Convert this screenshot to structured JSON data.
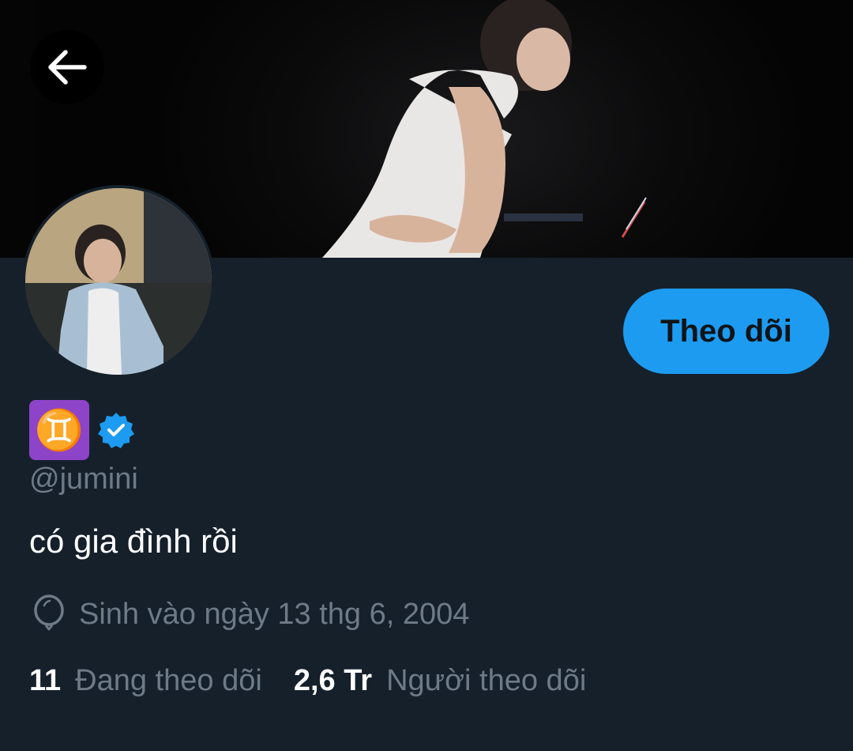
{
  "header": {
    "back_icon": "arrow-left-icon"
  },
  "profile": {
    "name_emoji": "♊",
    "verified_icon": "verified-badge-icon",
    "handle": "@jumini",
    "bio": "có gia đình rồi",
    "birth": "Sinh vào ngày 13 thg 6, 2004",
    "birth_icon": "balloon-icon",
    "follow_label": "Theo dõi"
  },
  "stats": {
    "following_count": "11",
    "following_label": "Đang theo dõi",
    "followers_count": "2,6 Tr",
    "followers_label": "Người theo dõi"
  },
  "colors": {
    "background": "#15202b",
    "accent": "#1d9bf0",
    "secondary_text": "#6e7b87",
    "gemini_badge": "#8e44c8"
  }
}
